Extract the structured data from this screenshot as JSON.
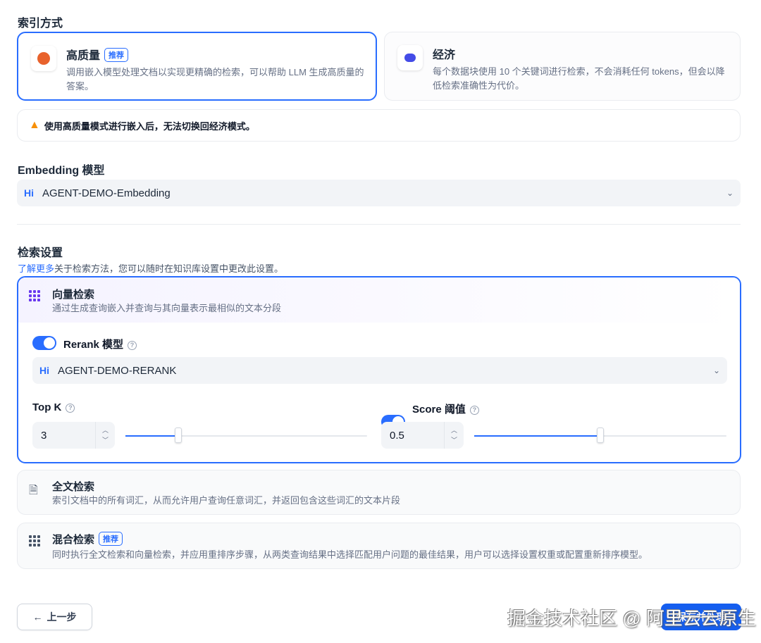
{
  "index_mode": {
    "label": "索引方式",
    "high": {
      "title": "高质量",
      "badge": "推荐",
      "desc": "调用嵌入模型处理文档以实现更精确的检索，可以帮助 LLM 生成高质量的答案。"
    },
    "economy": {
      "title": "经济",
      "desc": "每个数据块使用 10 个关键词进行检索，不会消耗任何 tokens，但会以降低检索准确性为代价。"
    },
    "warning": "使用高质量模式进行嵌入后，无法切换回经济模式。"
  },
  "embedding": {
    "label": "Embedding 模型",
    "model": "AGENT-DEMO-Embedding",
    "logo": "Hi"
  },
  "retrieval": {
    "label": "检索设置",
    "learn_more": "了解更多",
    "hint": "关于检索方法，您可以随时在知识库设置中更改此设置。",
    "vector": {
      "title": "向量检索",
      "desc": "通过生成查询嵌入并查询与其向量表示最相似的文本分段",
      "rerank_label": "Rerank 模型",
      "rerank_enabled": true,
      "rerank_model": "AGENT-DEMO-RERANK",
      "topk_label": "Top K",
      "topk": "3",
      "topk_fraction": 0.22,
      "score_label": "Score 阈值",
      "score_enabled": true,
      "score": "0.5",
      "score_fraction": 0.5
    },
    "fulltext": {
      "title": "全文检索",
      "desc": "索引文档中的所有词汇，从而允许用户查询任意词汇，并返回包含这些词汇的文本片段"
    },
    "hybrid": {
      "title": "混合检索",
      "badge": "推荐",
      "desc": "同时执行全文检索和向量检索，并应用重排序步骤，从两类查询结果中选择匹配用户问题的最佳结果，用户可以选择设置权重或配置重新排序模型。"
    }
  },
  "footer": {
    "prev": "上一步",
    "next": "保存并处理",
    "watermark": "掘金技术社区 @ 阿里云云原生"
  }
}
